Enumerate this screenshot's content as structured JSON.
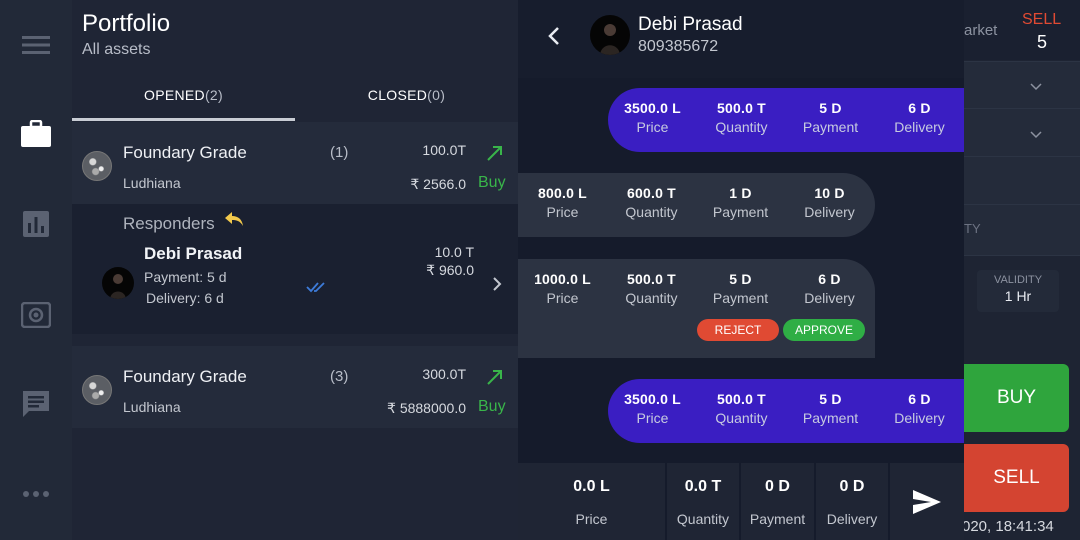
{
  "nav": {
    "icons": [
      "menu-icon",
      "briefcase-icon",
      "bar-chart-icon",
      "radar-icon",
      "chat-icon",
      "more-icon"
    ]
  },
  "portfolio": {
    "title": "Portfolio",
    "subtitle": "All assets",
    "tabs": [
      {
        "label": "OPENED",
        "count": "(2)"
      },
      {
        "label": "CLOSED",
        "count": "(0)"
      }
    ],
    "items": [
      {
        "name": "Foundary Grade",
        "city": "Ludhiana",
        "count": "(1)",
        "qty": "100.0T",
        "price": "₹ 2566.0",
        "action": "Buy"
      },
      {
        "name": "Foundary Grade",
        "city": "Ludhiana",
        "count": "(3)",
        "qty": "300.0T",
        "price": "₹ 5888000.0",
        "action": "Buy"
      }
    ],
    "responders": {
      "title": "Responders",
      "name": "Debi Prasad",
      "payment": "Payment: 5 d",
      "delivery": "Delivery: 6 d",
      "qty": "10.0 T",
      "price": "₹ 960.0"
    }
  },
  "chat": {
    "name": "Debi Prasad",
    "phone": "809385672",
    "messages": [
      {
        "dir": "out",
        "cells": [
          {
            "v": "3500.0 L",
            "l": "Price"
          },
          {
            "v": "500.0 T",
            "l": "Quantity"
          },
          {
            "v": "5 D",
            "l": "Payment"
          },
          {
            "v": "6 D",
            "l": "Delivery"
          }
        ]
      },
      {
        "dir": "in",
        "cells": [
          {
            "v": "800.0 L",
            "l": "Price"
          },
          {
            "v": "600.0 T",
            "l": "Quantity"
          },
          {
            "v": "1 D",
            "l": "Payment"
          },
          {
            "v": "10 D",
            "l": "Delivery"
          }
        ]
      },
      {
        "dir": "in",
        "cells": [
          {
            "v": "1000.0 L",
            "l": "Price"
          },
          {
            "v": "500.0 T",
            "l": "Quantity"
          },
          {
            "v": "5 D",
            "l": "Payment"
          },
          {
            "v": "6 D",
            "l": "Delivery"
          }
        ],
        "reject": "REJECT",
        "approve": "APPROVE"
      },
      {
        "dir": "out",
        "cells": [
          {
            "v": "3500.0 L",
            "l": "Price"
          },
          {
            "v": "500.0 T",
            "l": "Quantity"
          },
          {
            "v": "5 D",
            "l": "Payment"
          },
          {
            "v": "6 D",
            "l": "Delivery"
          }
        ]
      }
    ],
    "composer": [
      {
        "v": "0.0 L",
        "l": "Price"
      },
      {
        "v": "0.0 T",
        "l": "Quantity"
      },
      {
        "v": "0 D",
        "l": "Payment"
      },
      {
        "v": "0 D",
        "l": "Delivery"
      }
    ]
  },
  "trade": {
    "market_label": "arket",
    "sell_label": "SELL",
    "sell_count": "5",
    "field_hint": "TY",
    "validity_label": "VALIDITY",
    "validity_value": "1 Hr",
    "buy_button": "BUY",
    "sell_button": "SELL",
    "timestamp": "020, 18:41:34"
  },
  "colors": {
    "outgoing_bubble": "#3a1ec2",
    "incoming_bubble": "#2c3342",
    "buy_green": "#39b54a",
    "reject_red": "#e04a33",
    "approve_green": "#2fae45"
  }
}
